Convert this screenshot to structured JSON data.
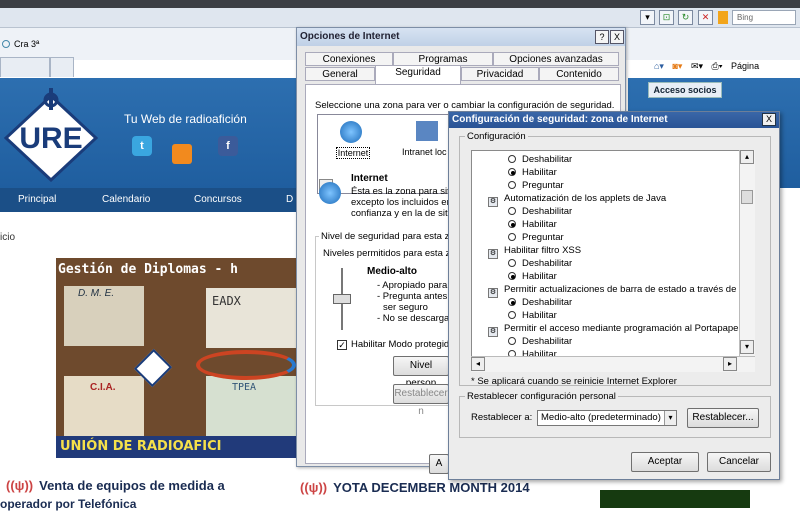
{
  "browser": {
    "tab_label": "Cra 3ª",
    "search_placeholder": "Bing",
    "cmd_page": "Página"
  },
  "page": {
    "tagline": "Tu Web de radioafición",
    "logo_text": "URE",
    "nav": [
      "Principal",
      "Calendario",
      "Concursos",
      "D"
    ],
    "breadcrumb": "icio",
    "acceso": "Acceso socios",
    "promo_title": "Gestión de Diplomas - h",
    "promo_footer": "UNIÓN DE RADIOAFICI",
    "promo_dme": "D. M. E.",
    "promo_cia": "C.I.A.",
    "promo_ead": "EADX",
    "promo_tpe": "TPEA",
    "news_1": "Venta de equipos de medida a",
    "news_1b": "operador por Telefónica",
    "news_2": "YOTA DECEMBER MONTH 2014"
  },
  "internet_options": {
    "title": "Opciones de Internet",
    "help_btn": "?",
    "close_btn": "X",
    "tabs_row1": [
      "Conexiones",
      "Programas",
      "Opciones avanzadas"
    ],
    "tabs_row2": [
      "General",
      "Seguridad",
      "Privacidad",
      "Contenido"
    ],
    "zone_prompt": "Seleccione una zona para ver o cambiar la configuración de seguridad.",
    "zones": [
      "Internet",
      "Intranet loc"
    ],
    "zone_name": "Internet",
    "zone_desc": [
      "Ésta es la zona para sitio",
      "excepto los incluidos en l",
      "confianza y en la de sitio"
    ],
    "level_group": "Nivel de seguridad para esta zo",
    "level_allowed": "Niveles permitidos para esta z",
    "level_name": "Medio-alto",
    "level_bullets": [
      "- Apropiado para l",
      "- Pregunta antes d",
      "ser seguro",
      "- No se descargan"
    ],
    "protected_mode": "Habilitar Modo protegido",
    "btn_custom": "Nivel person",
    "btn_default": "Restablecer n",
    "btn_accept": "A"
  },
  "security_settings": {
    "title": "Configuración de seguridad: zona de Internet",
    "close_btn": "X",
    "group": "Configuración",
    "items": [
      {
        "type": "opt",
        "label": "Deshabilitar",
        "on": false
      },
      {
        "type": "opt",
        "label": "Habilitar",
        "on": true
      },
      {
        "type": "opt",
        "label": "Preguntar",
        "on": false
      },
      {
        "type": "head",
        "label": "Automatización de los applets de Java"
      },
      {
        "type": "opt",
        "label": "Deshabilitar",
        "on": false
      },
      {
        "type": "opt",
        "label": "Habilitar",
        "on": true
      },
      {
        "type": "opt",
        "label": "Preguntar",
        "on": false
      },
      {
        "type": "head",
        "label": "Habilitar filtro XSS"
      },
      {
        "type": "opt",
        "label": "Deshabilitar",
        "on": false
      },
      {
        "type": "opt",
        "label": "Habilitar",
        "on": true
      },
      {
        "type": "head",
        "label": "Permitir actualizaciones de barra de estado a través de script"
      },
      {
        "type": "opt",
        "label": "Deshabilitar",
        "on": true
      },
      {
        "type": "opt",
        "label": "Habilitar",
        "on": false
      },
      {
        "type": "head",
        "label": "Permitir el acceso mediante programación al Portapapeles"
      },
      {
        "type": "opt",
        "label": "Deshabilitar",
        "on": false
      },
      {
        "type": "opt",
        "label": "Habilitar",
        "on": false
      }
    ],
    "note": "* Se aplicará cuando se reinicie Internet Explorer",
    "reset_group": "Restablecer configuración personal",
    "reset_to_label": "Restablecer a:",
    "reset_value": "Medio-alto (predeterminado)",
    "btn_reset": "Restablecer...",
    "btn_accept": "Aceptar",
    "btn_cancel": "Cancelar"
  }
}
